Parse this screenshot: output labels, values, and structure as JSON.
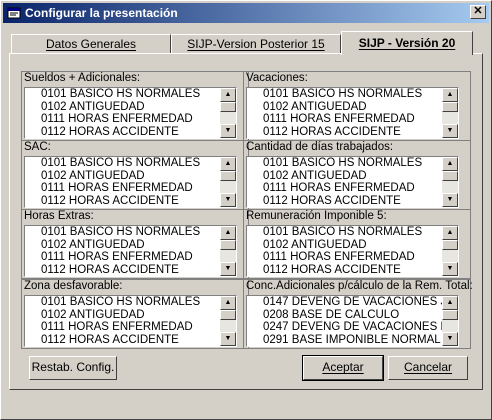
{
  "window": {
    "title": "Configurar la presentación"
  },
  "tabs": [
    {
      "label": "Datos Generales",
      "active": false
    },
    {
      "label": "SIJP-Version Posterior 15",
      "active": false
    },
    {
      "label": "SIJP - Versión 20",
      "active": true
    }
  ],
  "groups": [
    {
      "label": "Sueldos + Adicionales:",
      "items": [
        "0101  BASICO HS NORMALES",
        "0102  ANTIGUEDAD",
        "0111  HORAS ENFERMEDAD",
        "0112  HORAS ACCIDENTE"
      ]
    },
    {
      "label": "Vacaciones:",
      "items": [
        "0101  BASICO HS NORMALES",
        "0102  ANTIGUEDAD",
        "0111  HORAS ENFERMEDAD",
        "0112  HORAS ACCIDENTE"
      ]
    },
    {
      "label": "SAC:",
      "items": [
        "0101  BASICO HS NORMALES",
        "0102  ANTIGUEDAD",
        "0111  HORAS ENFERMEDAD",
        "0112  HORAS ACCIDENTE"
      ]
    },
    {
      "label": "Cantidad de días trabajados:",
      "items": [
        "0101  BASICO HS NORMALES",
        "0102  ANTIGUEDAD",
        "0111  HORAS ENFERMEDAD",
        "0112  HORAS ACCIDENTE"
      ]
    },
    {
      "label": "Horas Extras:",
      "items": [
        "0101  BASICO HS NORMALES",
        "0102  ANTIGUEDAD",
        "0111  HORAS ENFERMEDAD",
        "0112  HORAS ACCIDENTE"
      ]
    },
    {
      "label": "Remuneración Imponible 5:",
      "items": [
        "0101  BASICO HS NORMALES",
        "0102  ANTIGUEDAD",
        "0111  HORAS ENFERMEDAD",
        "0112  HORAS ACCIDENTE"
      ]
    },
    {
      "label": "Zona desfavorable:",
      "items": [
        "0101  BASICO HS NORMALES",
        "0102  ANTIGUEDAD",
        "0111  HORAS ENFERMEDAD",
        "0112  HORAS ACCIDENTE"
      ]
    },
    {
      "label": "Conc.Adicionales p/cálculo de la Rem. Total:",
      "items": [
        "0147  DEVENG DE VACACIONES JO",
        "0208  BASE DE CALCULO",
        "0247  DEVENG DE VACACIONES ME",
        "0291  BASE IMPONIBLE NORMAL R"
      ]
    }
  ],
  "buttons": {
    "reset": "Restab. Config.",
    "accept": "Aceptar",
    "cancel": "Cancelar"
  },
  "icons": {
    "close": "close-icon",
    "app": "window-config-icon",
    "scroll_up": "arrow-up-icon",
    "scroll_down": "arrow-down-icon"
  }
}
